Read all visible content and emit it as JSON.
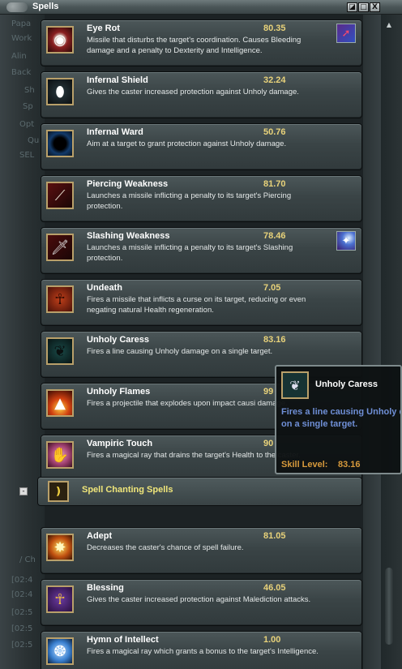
{
  "window": {
    "title": "Spells",
    "buttons": {
      "restore": "◪",
      "minimize": "□",
      "close": "X"
    }
  },
  "spells": [
    {
      "name": "Eye Rot",
      "level": "80.35",
      "desc": "Missile that disturbs the target's coordination.  Causes Bleeding damage and a penalty to Dexterity and Intelligence.",
      "icon": "eye-icon",
      "badge": "run-icon"
    },
    {
      "name": "Infernal Shield",
      "level": "32.24",
      "desc": "Gives the caster increased protection against Unholy damage.",
      "icon": "mask-icon"
    },
    {
      "name": "Infernal Ward",
      "level": "50.76",
      "desc": "Aim at a target to grant protection against Unholy damage.",
      "icon": "orb-icon"
    },
    {
      "name": "Piercing Weakness",
      "level": "81.70",
      "desc": "Launches a missile inflicting a penalty to its target's Piercing protection.",
      "icon": "spear-icon"
    },
    {
      "name": "Slashing Weakness",
      "level": "78.46",
      "desc": "Launches a missile inflicting a penalty to its target's Slashing protection.",
      "icon": "dagger-icon",
      "badge": "magic-bolt-icon"
    },
    {
      "name": "Undeath",
      "level": "7.05",
      "desc": "Fires a missile that inflicts a curse on its target, reducing or even negating natural Health regeneration.",
      "icon": "ankh-icon"
    },
    {
      "name": "Unholy Caress",
      "level": "83.16",
      "desc": "Fires a line causing Unholy damage on a single target.",
      "icon": "shadow-hand-icon"
    },
    {
      "name": "Unholy Flames",
      "level": "99",
      "desc": "Fires a projectile that explodes upon impact causi damage.",
      "icon": "flame-icon"
    },
    {
      "name": "Vampiric Touch",
      "level": "90",
      "desc": "Fires a magical ray that drains the target's Health to the caster.",
      "icon": "bat-icon"
    }
  ],
  "category": {
    "label": "Spell Chanting Spells",
    "collapse_symbol": "-",
    "icon": "chant-icon"
  },
  "chant_spells": [
    {
      "name": "Adept",
      "level": "81.05",
      "desc": "Decreases the caster's chance of spell failure.",
      "icon": "star-icon"
    },
    {
      "name": "Blessing",
      "level": "46.05",
      "desc": "Gives the caster increased protection against Malediction attacks.",
      "icon": "ankh-gold-icon"
    },
    {
      "name": "Hymn of Intellect",
      "level": "1.00",
      "desc": "Fires a magical ray which grants a bonus to the target's Intelligence.",
      "icon": "brain-icon"
    }
  ],
  "tooltip": {
    "name": "Unholy Caress",
    "desc": "Fires a line causing Unholy damage on a single target.",
    "level_label": "Skill Level:",
    "level_value": "83.16"
  },
  "background_text": [
    "Papa",
    "Work",
    "Alin",
    "Back",
    "Sh",
    "Sp",
    "Opt",
    "Qu",
    "SEL",
    "/ Ch",
    "[02:4",
    "[02:4",
    "[02:5",
    "[02:5",
    "[02:5"
  ]
}
